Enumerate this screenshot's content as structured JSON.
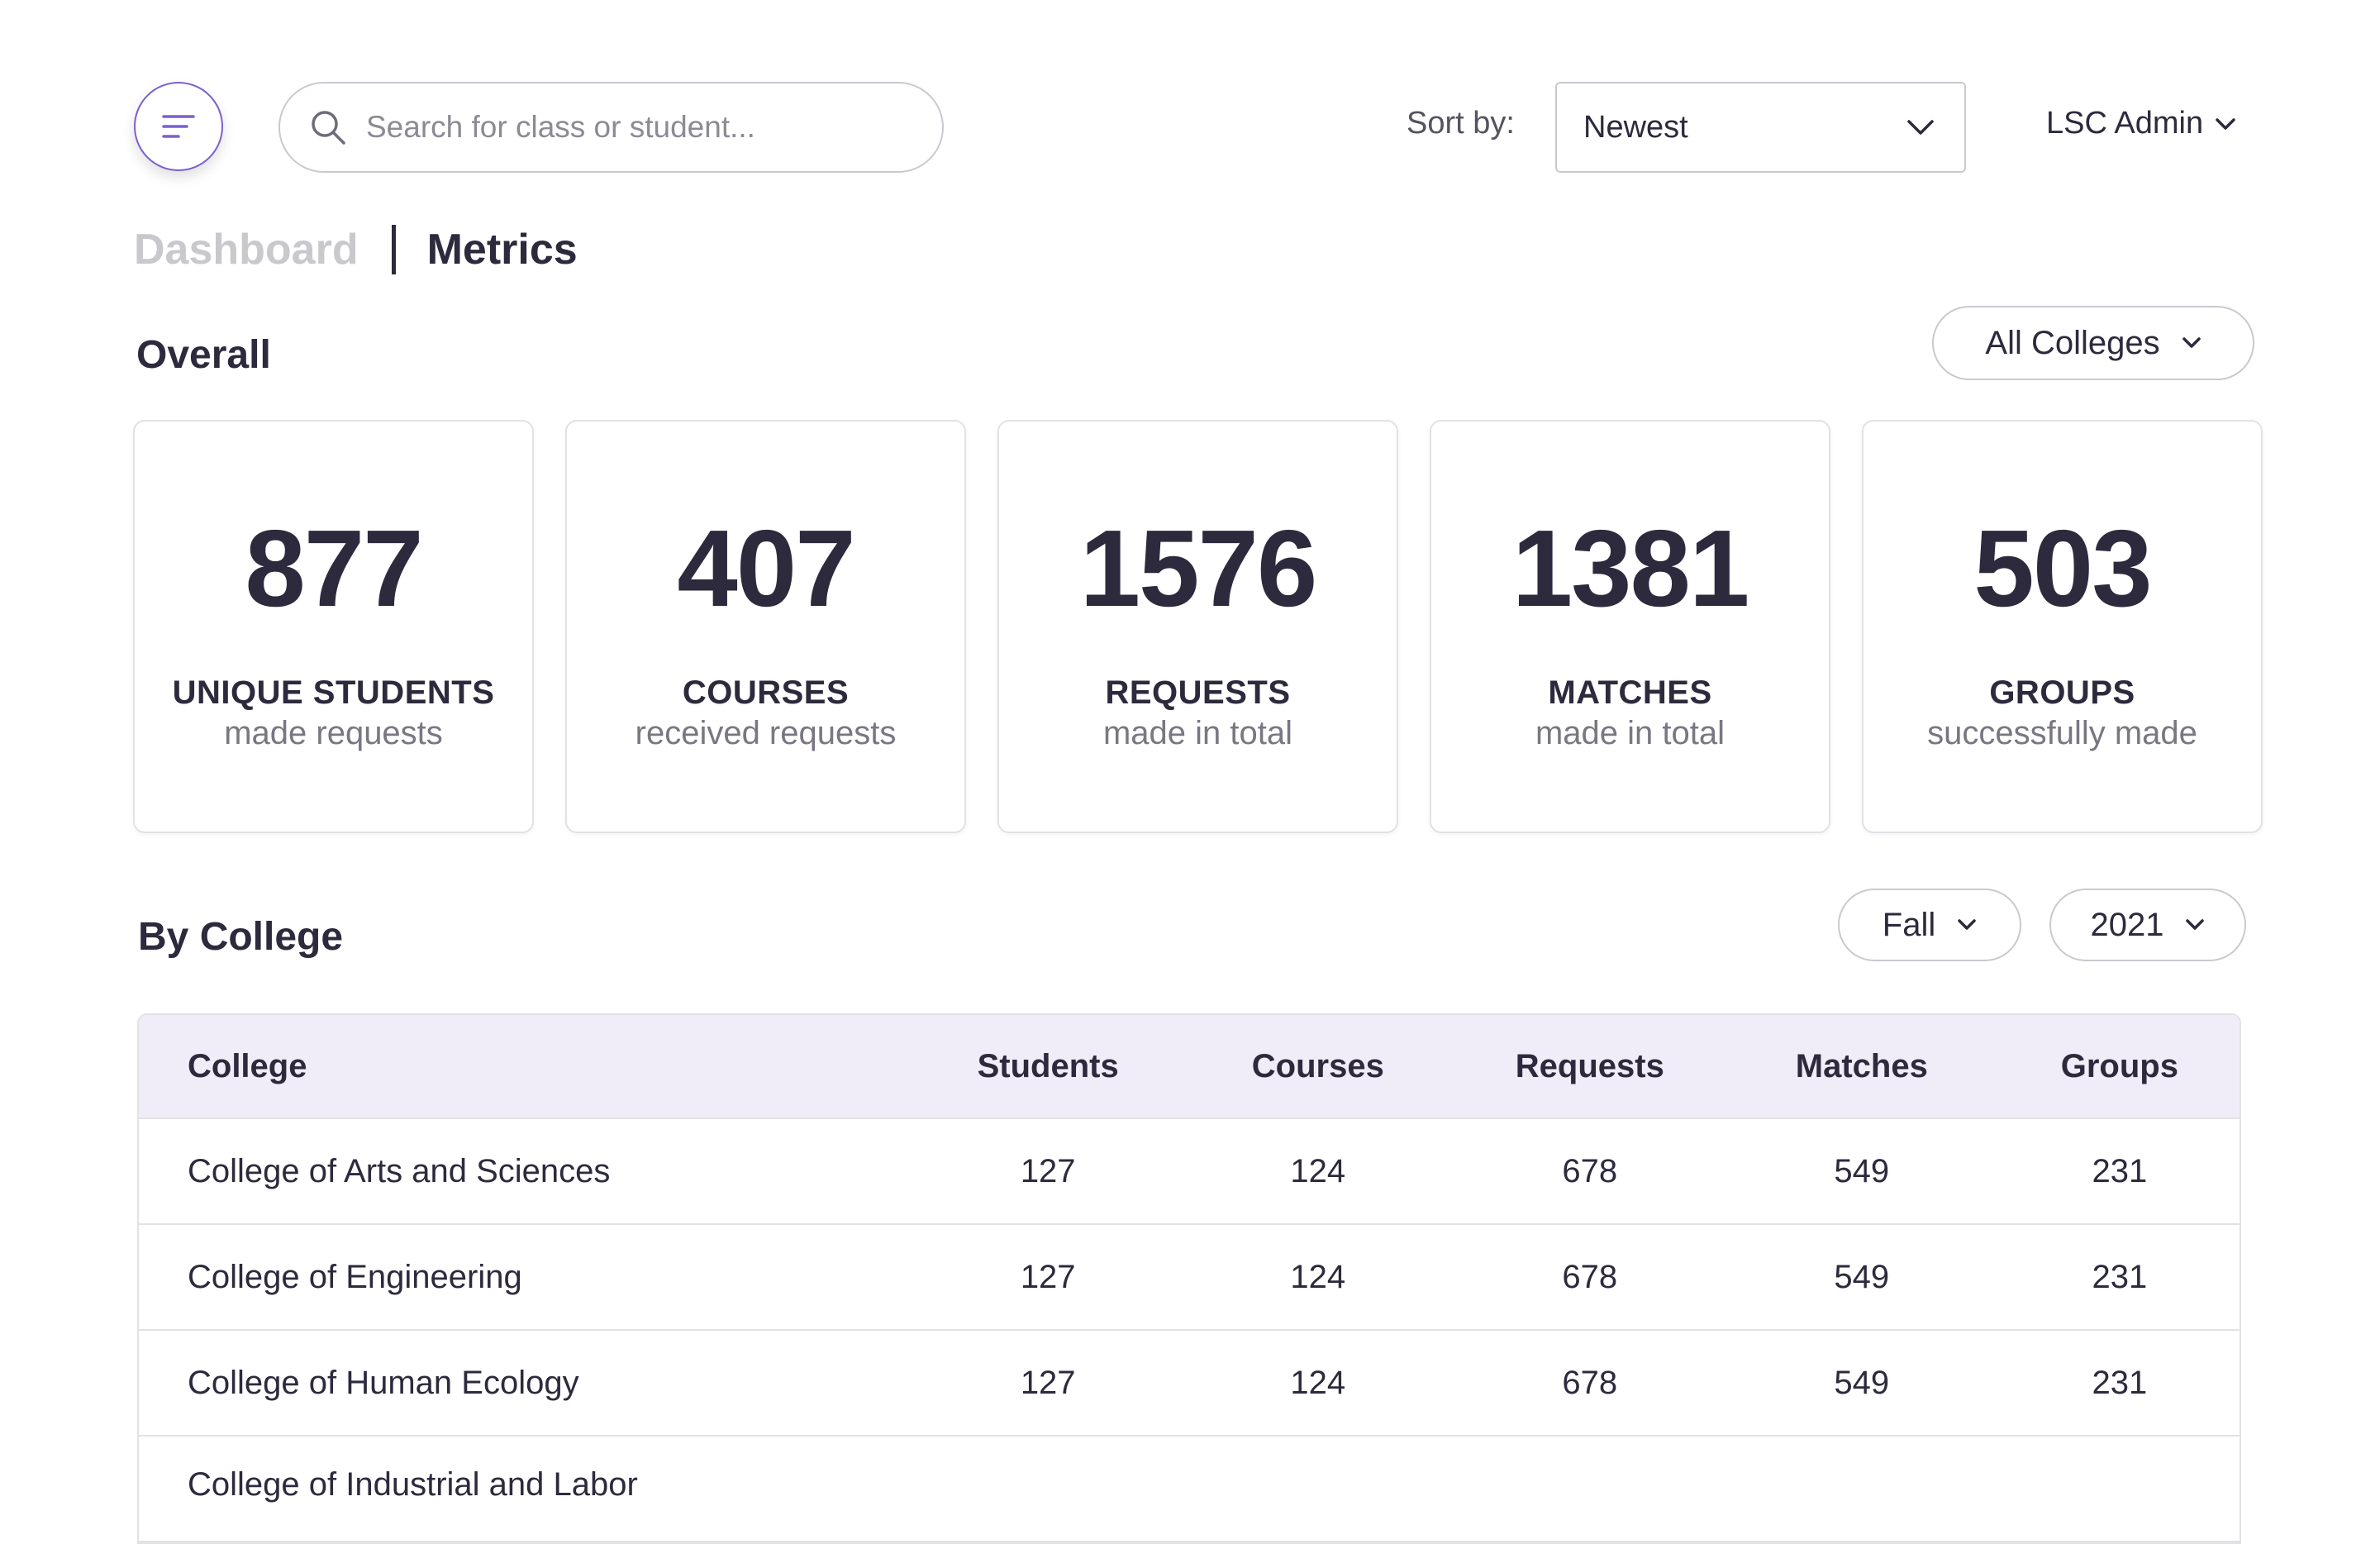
{
  "header": {
    "search_placeholder": "Search for class or student...",
    "sort_label": "Sort by:",
    "sort_value": "Newest",
    "user_menu": "LSC Admin"
  },
  "breadcrumb": {
    "dashboard": "Dashboard",
    "current": "Metrics"
  },
  "overall": {
    "title": "Overall",
    "filter": "All Colleges",
    "cards": [
      {
        "value": "877",
        "label": "UNIQUE STUDENTS",
        "sub": "made requests"
      },
      {
        "value": "407",
        "label": "COURSES",
        "sub": "received requests"
      },
      {
        "value": "1576",
        "label": "REQUESTS",
        "sub": "made in total"
      },
      {
        "value": "1381",
        "label": "MATCHES",
        "sub": "made in total"
      },
      {
        "value": "503",
        "label": "GROUPS",
        "sub": "successfully made"
      }
    ]
  },
  "by_college": {
    "title": "By College",
    "term": "Fall",
    "year": "2021",
    "columns": [
      "College",
      "Students",
      "Courses",
      "Requests",
      "Matches",
      "Groups"
    ],
    "rows": [
      [
        "College of Arts and Sciences",
        "127",
        "124",
        "678",
        "549",
        "231"
      ],
      [
        "College of Engineering",
        "127",
        "124",
        "678",
        "549",
        "231"
      ],
      [
        "College of Human Ecology",
        "127",
        "124",
        "678",
        "549",
        "231"
      ],
      [
        "College of Industrial and Labor",
        "",
        "",
        "",
        "",
        ""
      ]
    ]
  },
  "colors": {
    "accent": "#7b5fd0",
    "text": "#2e2a3d",
    "muted": "#7a7682",
    "table_header_bg": "#f1edf8"
  }
}
